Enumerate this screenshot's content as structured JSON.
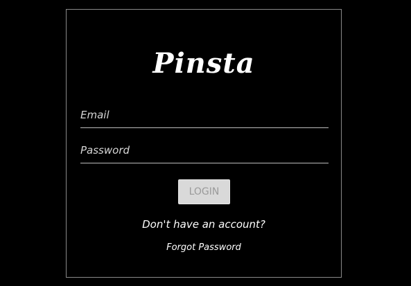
{
  "app": {
    "logo_text": "Pinsta"
  },
  "form": {
    "email": {
      "value": "",
      "placeholder": "Email"
    },
    "password": {
      "value": "",
      "placeholder": "Password"
    },
    "login_label": "LOGIN",
    "login_enabled": false
  },
  "links": {
    "signup": "Don't have an account?",
    "forgot_password": "Forgot Password"
  },
  "colors": {
    "background": "#000000",
    "card_border": "#8a8a8a",
    "text": "#ffffff",
    "button_disabled_bg": "#d9d9d9",
    "button_disabled_text": "#9a9a9a",
    "input_underline": "#bdbdbd"
  }
}
